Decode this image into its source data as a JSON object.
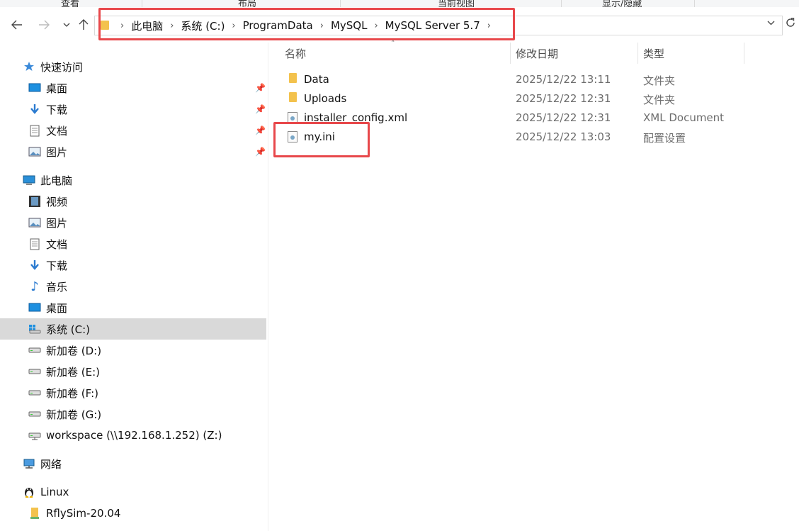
{
  "ribbon": {
    "tabs": [
      "查看",
      "布局",
      "当前视图",
      "显示/隐藏"
    ]
  },
  "nav": {
    "back_icon": "arrow-left-icon",
    "forward_icon": "arrow-right-icon",
    "recent_icon": "chevron-down-icon",
    "up_icon": "arrow-up-icon",
    "address": [
      "此电脑",
      "系统 (C:)",
      "ProgramData",
      "MySQL",
      "MySQL Server 5.7"
    ],
    "refresh_icon": "refresh-icon"
  },
  "sidebar": {
    "quick_access": {
      "label": "快速访问",
      "items": [
        {
          "label": "桌面",
          "icon": "desktop-icon",
          "pinned": true
        },
        {
          "label": "下载",
          "icon": "download-icon",
          "pinned": true
        },
        {
          "label": "文档",
          "icon": "document-icon",
          "pinned": true
        },
        {
          "label": "图片",
          "icon": "picture-icon",
          "pinned": true
        }
      ]
    },
    "this_pc": {
      "label": "此电脑",
      "items": [
        {
          "label": "视频",
          "icon": "video-icon"
        },
        {
          "label": "图片",
          "icon": "picture-icon"
        },
        {
          "label": "文档",
          "icon": "document-icon"
        },
        {
          "label": "下载",
          "icon": "download-icon"
        },
        {
          "label": "音乐",
          "icon": "music-icon"
        },
        {
          "label": "桌面",
          "icon": "desktop-icon"
        },
        {
          "label": "系统 (C:)",
          "icon": "windows-drive-icon",
          "selected": true
        },
        {
          "label": "新加卷 (D:)",
          "icon": "drive-icon"
        },
        {
          "label": "新加卷 (E:)",
          "icon": "drive-icon"
        },
        {
          "label": "新加卷 (F:)",
          "icon": "drive-icon"
        },
        {
          "label": "新加卷 (G:)",
          "icon": "drive-icon"
        },
        {
          "label": "workspace (\\\\192.168.1.252) (Z:)",
          "icon": "network-drive-icon"
        }
      ]
    },
    "network": {
      "label": "网络",
      "icon": "network-icon"
    },
    "linux": {
      "label": "Linux",
      "icon": "linux-icon"
    },
    "rflysim": {
      "label": "RflySim-20.04",
      "icon": "folder-icon"
    }
  },
  "columns": {
    "name": "名称",
    "date": "修改日期",
    "type": "类型"
  },
  "files": [
    {
      "name": "Data",
      "date": "2025/12/22 13:11",
      "type": "文件夹",
      "icon": "folder-icon"
    },
    {
      "name": "Uploads",
      "date": "2025/12/22 12:31",
      "type": "文件夹",
      "icon": "folder-icon"
    },
    {
      "name": "installer_config.xml",
      "date": "2025/12/22 12:31",
      "type": "XML Document",
      "icon": "xml-file-icon"
    },
    {
      "name": "my.ini",
      "date": "2025/12/22 13:03",
      "type": "配置设置",
      "icon": "config-file-icon"
    }
  ],
  "accent": {
    "highlight": "#e8484b",
    "folder": "#f3c24d",
    "selected": "#d9d9d9"
  }
}
